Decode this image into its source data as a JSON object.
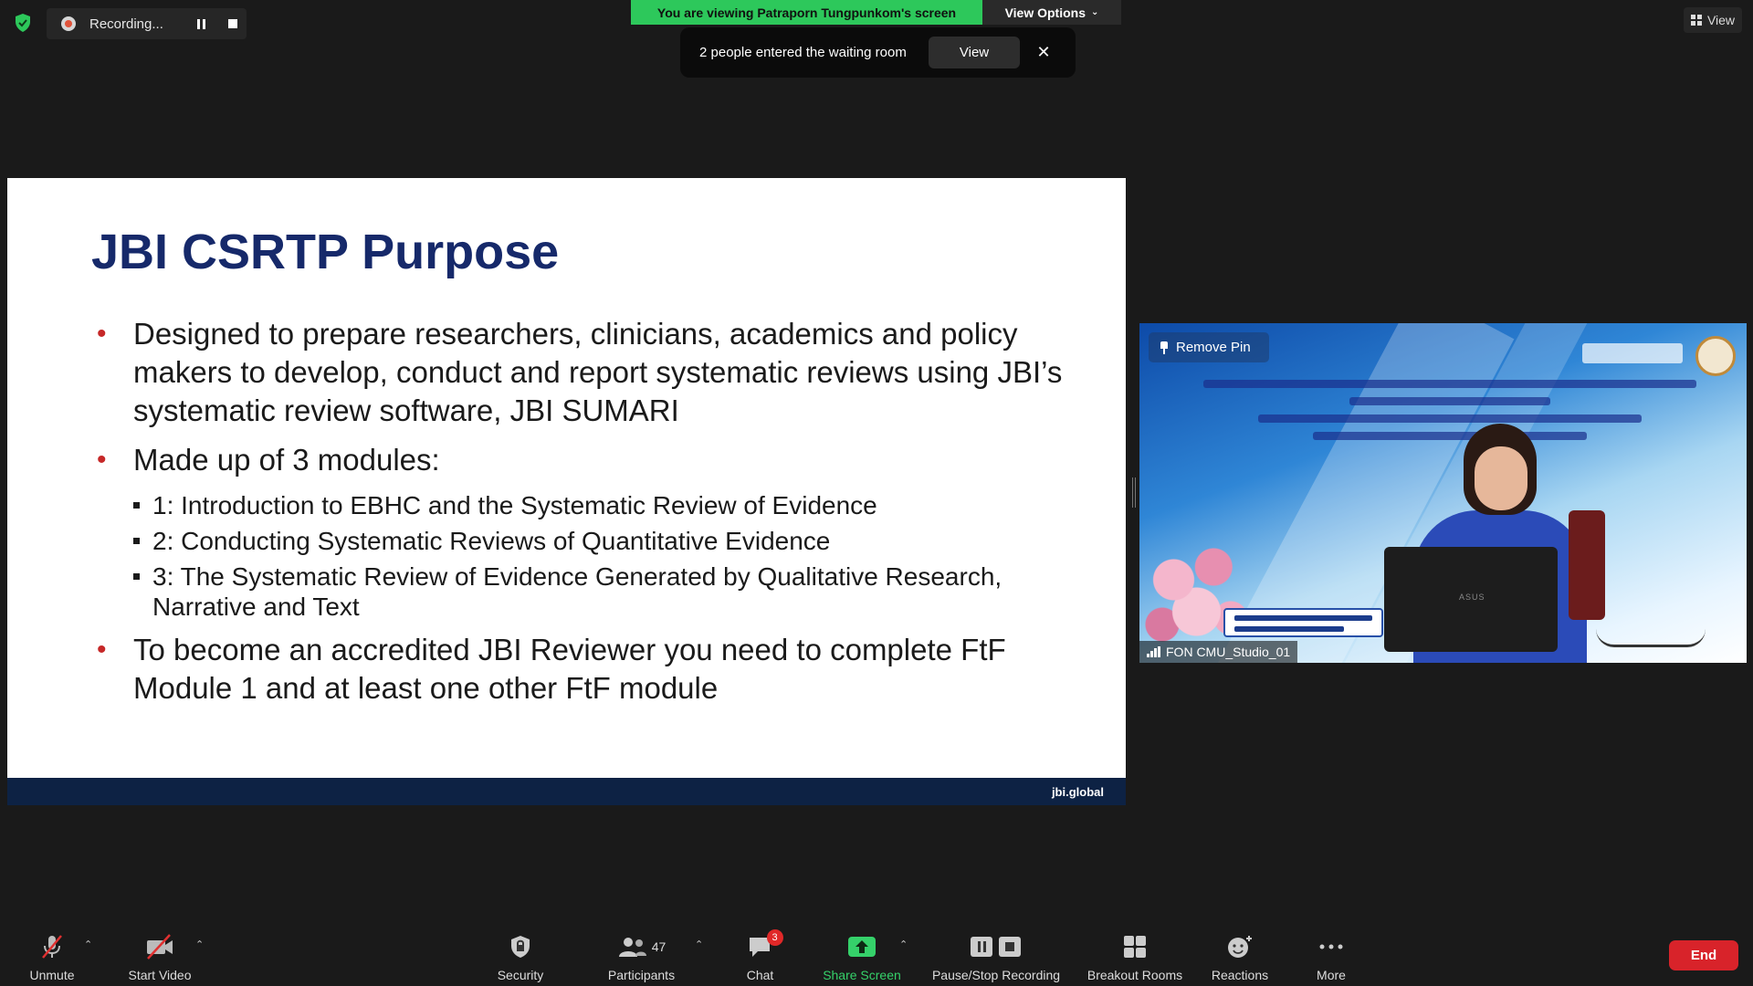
{
  "recording": {
    "label": "Recording...",
    "icons": [
      "shield-check-icon",
      "record-dot-icon",
      "pause-icon",
      "stop-icon"
    ]
  },
  "share_banner": {
    "text": "You are viewing Patraporn Tungpunkom's screen",
    "view_options": "View Options",
    "color": "#2dc85b"
  },
  "toast": {
    "text": "2 people entered the waiting room",
    "view_button": "View",
    "close_icon": "close-icon"
  },
  "top_right": {
    "view_label": "View"
  },
  "slide": {
    "title": "JBI CSRTP Purpose",
    "bullets": [
      "Designed to prepare researchers, clinicians, academics and policy makers to develop, conduct and report systematic reviews using JBI’s systematic review software, JBI SUMARI",
      "Made up of 3 modules:",
      "To become an accredited JBI Reviewer you need to complete FtF Module 1 and at least one other FtF module"
    ],
    "sub_bullets": [
      "1: Introduction to EBHC and the Systematic Review of Evidence",
      "2: Conducting Systematic Reviews of Quantitative Evidence",
      "3: The Systematic Review of Evidence Generated by Qualitative Research, Narrative and Text"
    ],
    "footer": "jbi.global",
    "title_color": "#16296a",
    "bullet_color": "#c62828",
    "footer_color": "#0d2244"
  },
  "video": {
    "remove_pin": "Remove Pin",
    "participant_name": "FON CMU_Studio_01"
  },
  "toolbar": {
    "unmute": "Unmute",
    "start_video": "Start Video",
    "security": "Security",
    "participants": "Participants",
    "participants_count": "47",
    "chat": "Chat",
    "chat_badge": "3",
    "share_screen": "Share Screen",
    "pause_stop_recording": "Pause/Stop Recording",
    "breakout_rooms": "Breakout Rooms",
    "reactions": "Reactions",
    "more": "More",
    "end": "End",
    "end_color": "#d8232a",
    "share_color": "#35d16a"
  }
}
